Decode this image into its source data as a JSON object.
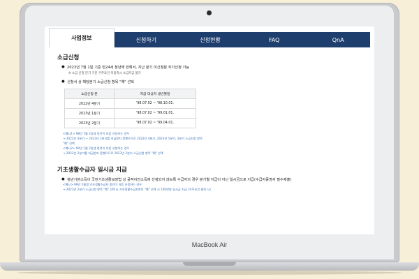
{
  "device": {
    "model": "MacBook Air"
  },
  "nav": {
    "tabs": [
      {
        "label": "사업정보"
      },
      {
        "label": "신청하기"
      },
      {
        "label": "신청현황"
      },
      {
        "label": "FAQ"
      },
      {
        "label": "QnA"
      }
    ]
  },
  "section1": {
    "title": "소급신청",
    "bullet1": "2023년 7월 1일 기준 만24세 청년에 한해서, 지난 분기 미신청분 추가신청 가능",
    "note1": "※ 소급 신청 분기 기준 거주요건 미충족시 소급지급 불가",
    "bullet2": "신청서 상 해당분기 소급신청 항목 \"예\" 선택",
    "table": {
      "headers": [
        "소급신청 분",
        "지급 대상자 생년월일"
      ],
      "rows": [
        [
          "2022년 4분기",
          "'98.07.02 ~ '98.10.01."
        ],
        [
          "2023년 1분기",
          "'98.07.02 ~ '99.01.01."
        ],
        [
          "2023년 2분기",
          "'98.07.02 ~ '99.04.01."
        ]
      ]
    },
    "links": [
      "<예시1> 98년 7월 2일생 청년이 처음 신청하는 경우",
      "→ 2022년 4분기 ~ 2023년 2분기를 지급받지 못했으므로 2022년 4분기, 2023년 1분기, 2분기 소급신청 항목",
      "\"예\" 선택",
      "<예시2> 99년 1월 2일생 청년이 처음 신청하는 경우",
      "→ 2023년 2분기를 지급받지 못했으므로 2023년 2분기 소급신청 항목 \"예\" 선택"
    ]
  },
  "section2": {
    "title": "기초생활수급자 일시금 지급",
    "bullet1": "청년기본소득이 국민기초생활보장법 상 공적이전소득에 산정되지 않도록 수급자의 경우 분기별 지급이 아닌 일시금으로 지급(수급자증명서 필수제출)",
    "links": [
      "<예시> 99년 2월생 기초생활수급자 청년이 처음 신청하는 경우",
      "→ 2023년 2분기 소급신청 항목 \"예\" 선택 & 기초생활수급자여부 \"예\" 선택 시 100만원 일시금 지급 (거주요건 충족 시)"
    ]
  }
}
